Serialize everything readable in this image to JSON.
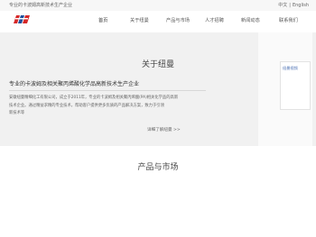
{
  "topbar": {
    "tagline": "专业的卡波姆高新技术生产企业",
    "lang_zh": "中文",
    "lang_sep": "|",
    "lang_en": "English"
  },
  "nav": {
    "items": [
      "首页",
      "关于纽曼",
      "产品与市场",
      "人才招聘",
      "新闻动态",
      "联系我们"
    ]
  },
  "about": {
    "title": "关于纽曼",
    "subtitle": "专业的卡波姆及相关聚丙烯酸化学品高新技术生产企业",
    "para_line1": "安徽纽曼精细化工有限公司，成立于2011年，专业的卡波姆及相关聚丙烯酸(PA)相关化学品的高新",
    "para_line2": "技术企业。通过精益求精的专业技术，帮助客户提供更多优质的产品解决方案，致力于引领",
    "para_line3": "新技术等",
    "more_link": "详细了解纽曼 >>"
  },
  "side": {
    "card_label": "纽曼视频"
  },
  "products": {
    "title": "产品与市场"
  },
  "colors": {
    "hero_bg": "#f1f1f1",
    "logo_red": "#d62828",
    "logo_blue": "#1d4f9c"
  }
}
